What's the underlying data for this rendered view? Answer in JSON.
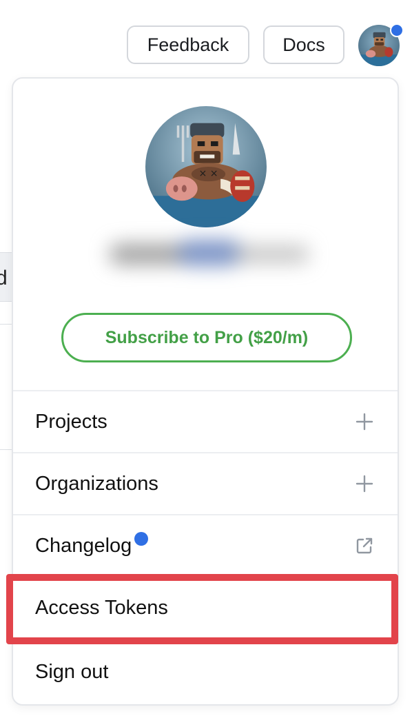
{
  "topbar": {
    "feedback_label": "Feedback",
    "docs_label": "Docs"
  },
  "colors": {
    "accent_green": "#43a047",
    "notification_blue": "#2f6fe4",
    "highlight_red": "#e2444b"
  },
  "profile_menu": {
    "subscribe_label": "Subscribe to Pro ($20/m)",
    "items": [
      {
        "label": "Projects",
        "icon": "plus-icon"
      },
      {
        "label": "Organizations",
        "icon": "plus-icon"
      },
      {
        "label": "Changelog",
        "icon": "external-link-icon",
        "has_new_indicator": true
      },
      {
        "label": "Access Tokens",
        "highlighted": true
      },
      {
        "label": "Sign out"
      }
    ]
  },
  "background_fragment": {
    "text": "d"
  }
}
